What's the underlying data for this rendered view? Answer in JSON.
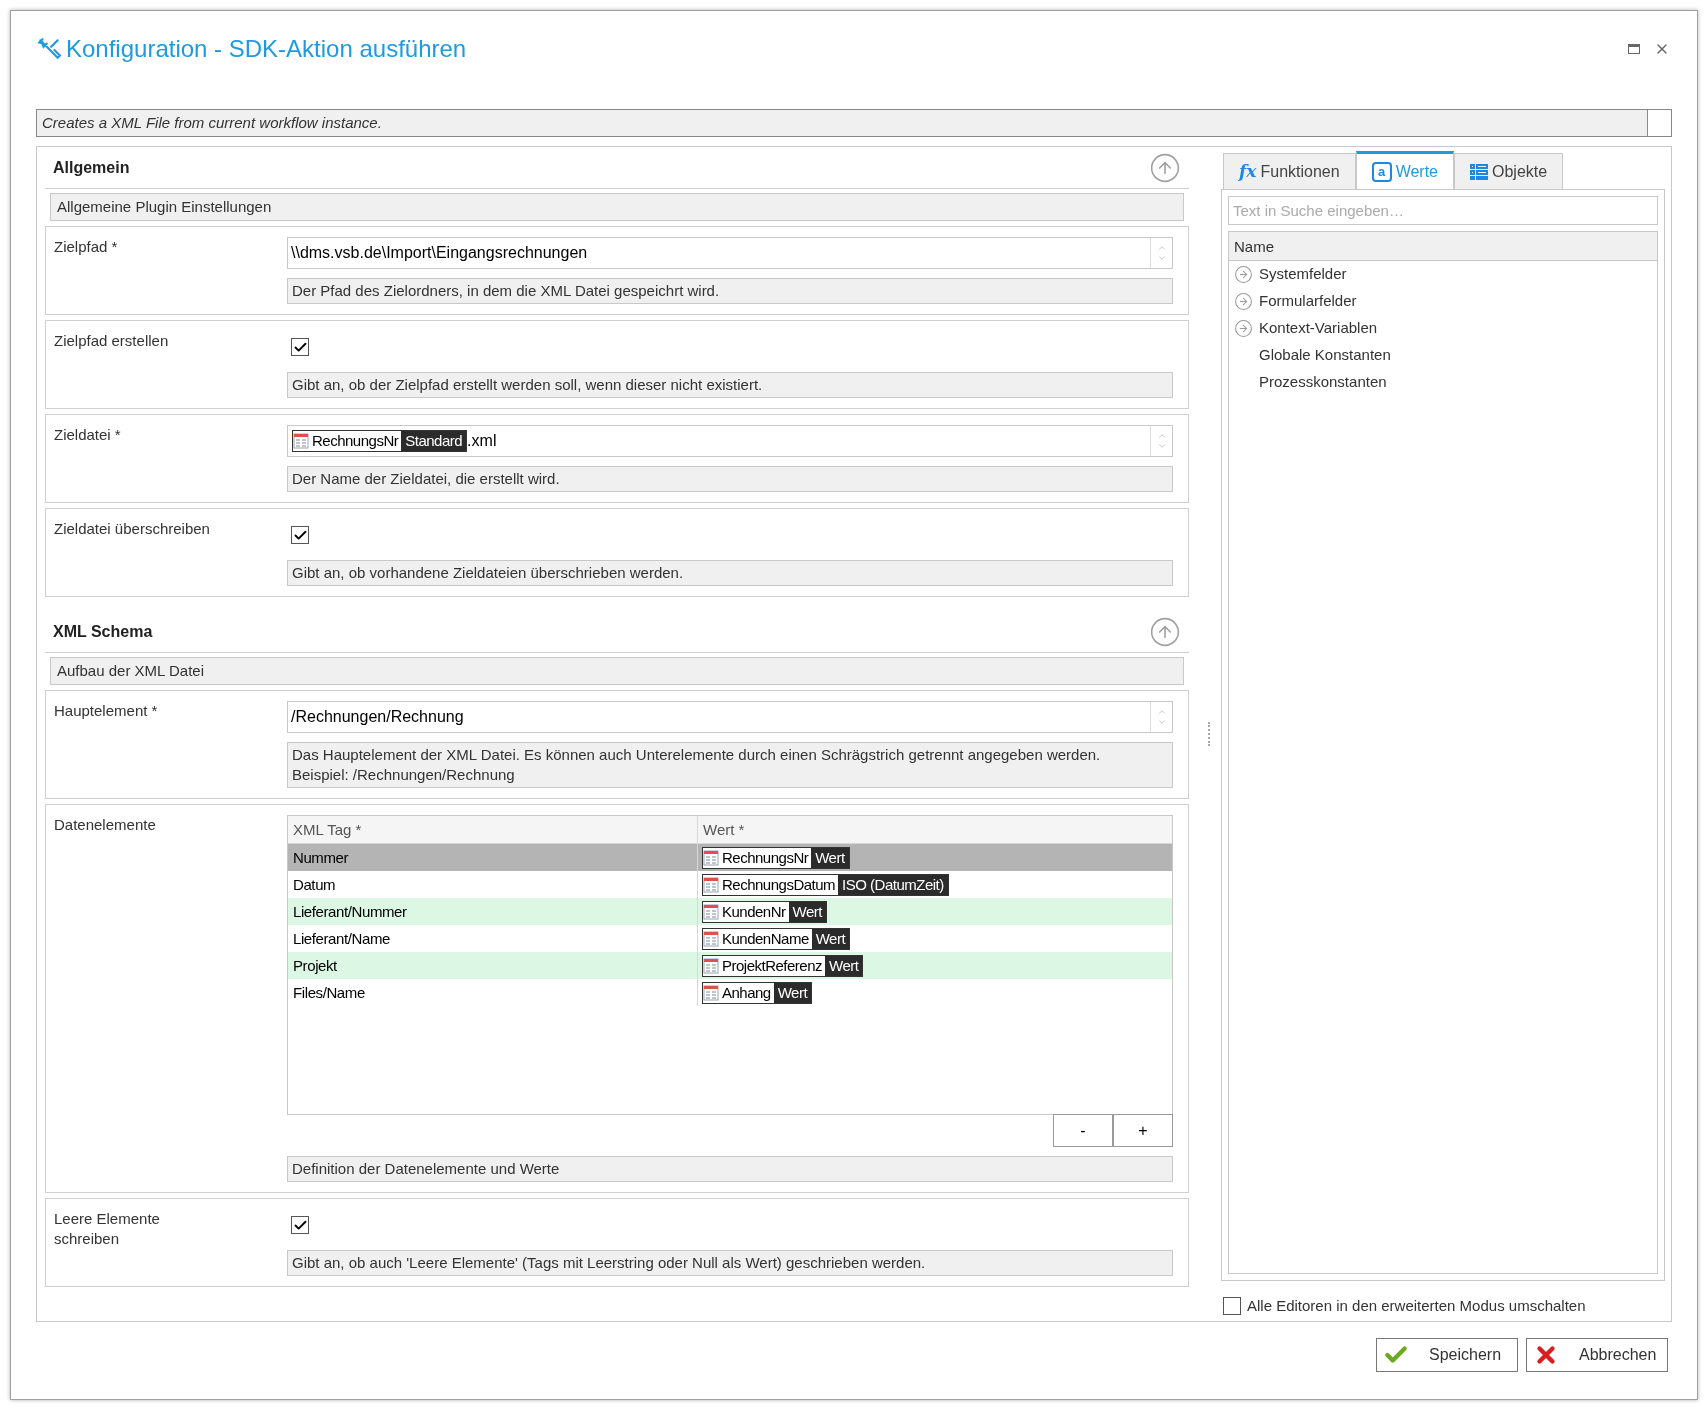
{
  "window": {
    "title": "Konfiguration - SDK-Aktion ausführen"
  },
  "description": "Creates a XML File from current workflow instance.",
  "sections": [
    {
      "title": "Allgemein",
      "subtitle": "Allgemeine Plugin Einstellungen",
      "fields": [
        {
          "kind": "text",
          "label": "Zielpfad *",
          "value": "\\\\dms.vsb.de\\Import\\Eingangsrechnungen",
          "hint": "Der Pfad des Zielordners, in dem die XML Datei gespeichrt wird."
        },
        {
          "kind": "checkbox",
          "label": "Zielpfad erstellen",
          "checked": true,
          "hint": "Gibt an, ob der Zielpfad erstellt werden soll, wenn dieser nicht existiert."
        },
        {
          "kind": "token",
          "label": "Zieldatei *",
          "token": {
            "name": "RechnungsNr",
            "format": "Standard"
          },
          "suffix": ".xml",
          "hint": "Der Name der Zieldatei, die erstellt wird."
        },
        {
          "kind": "checkbox",
          "label": "Zieldatei überschreiben",
          "checked": true,
          "hint": "Gibt an, ob vorhandene Zieldateien überschrieben werden."
        }
      ]
    },
    {
      "title": "XML Schema",
      "subtitle": "Aufbau der XML Datei",
      "fields": [
        {
          "kind": "text",
          "label": "Hauptelement *",
          "value": "/Rechnungen/Rechnung",
          "hint": "Das Hauptelement der XML Datei. Es können auch Unterelemente durch einen Schrägstrich getrennt angegeben werden.\nBeispiel: /Rechnungen/Rechnung"
        },
        {
          "kind": "table",
          "label": "Datenelemente",
          "columns": [
            "XML Tag *",
            "Wert *"
          ],
          "rows": [
            {
              "tag": "Nummer",
              "token": {
                "name": "RechnungsNr",
                "format": "Wert"
              },
              "selected": true
            },
            {
              "tag": "Datum",
              "token": {
                "name": "RechnungsDatum",
                "format": "ISO (DatumZeit)"
              },
              "selected": false
            },
            {
              "tag": "Lieferant/Nummer",
              "token": {
                "name": "KundenNr",
                "format": "Wert"
              },
              "selected": false
            },
            {
              "tag": "Lieferant/Name",
              "token": {
                "name": "KundenName",
                "format": "Wert"
              },
              "selected": false
            },
            {
              "tag": "Projekt",
              "token": {
                "name": "ProjektReferenz",
                "format": "Wert"
              },
              "selected": false
            },
            {
              "tag": "Files/Name",
              "token": {
                "name": "Anhang",
                "format": "Wert"
              },
              "selected": false
            }
          ],
          "buttons": [
            "-",
            "+"
          ],
          "hint": "Definition der Datenelemente und Werte"
        },
        {
          "kind": "checkbox",
          "label": "Leere Elemente\nschreiben",
          "checked": true,
          "hint": "Gibt an, ob auch 'Leere Elemente' (Tags mit Leerstring oder Null als Wert) geschrieben werden."
        }
      ]
    }
  ],
  "side_panel": {
    "tabs": [
      {
        "kind": "functions",
        "glyph": "fx",
        "label": "Funktionen",
        "selected": false
      },
      {
        "kind": "values",
        "glyph": "a",
        "label": "Werte",
        "selected": true
      },
      {
        "kind": "objects",
        "label": "Objekte",
        "selected": false
      }
    ],
    "search": {
      "placeholder": "Text in Suche eingeben…"
    },
    "column": "Name",
    "items": [
      {
        "label": "Systemfelder",
        "expandable": true
      },
      {
        "label": "Formularfelder",
        "expandable": true
      },
      {
        "label": "Kontext-Variablen",
        "expandable": true
      },
      {
        "label": "Globale Konstanten",
        "expandable": false
      },
      {
        "label": "Prozesskonstanten",
        "expandable": false
      }
    ]
  },
  "advanced_mode": {
    "label": "Alle Editoren in den erweiterten Modus umschalten",
    "checked": false
  },
  "buttons": [
    {
      "kind": "save",
      "label": "Speichern"
    },
    {
      "kind": "cancel",
      "label": "Abbrechen"
    }
  ]
}
